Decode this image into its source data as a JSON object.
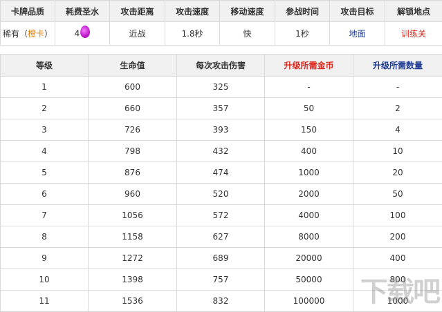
{
  "card": {
    "headers": [
      "卡牌品质",
      "耗费圣水",
      "攻击距离",
      "攻击速度",
      "移动速度",
      "参战时间",
      "攻击目标",
      "解锁地点"
    ],
    "quality_prefix": "稀有（",
    "quality_link": "橙卡",
    "quality_suffix": "）",
    "elixir_cost": "4",
    "elixir_icon": "elixir-drop-icon",
    "range": "近战",
    "attack_speed": "1.8秒",
    "move_speed": "快",
    "deploy_time": "1秒",
    "target": "地面",
    "unlock": "训练关"
  },
  "levels": {
    "headers": [
      "等级",
      "生命值",
      "每次攻击伤害",
      "升级所需金币",
      "升级所需数量"
    ],
    "rows": [
      [
        "1",
        "600",
        "325",
        "-",
        "-"
      ],
      [
        "2",
        "660",
        "357",
        "50",
        "2"
      ],
      [
        "3",
        "726",
        "393",
        "150",
        "4"
      ],
      [
        "4",
        "798",
        "432",
        "400",
        "10"
      ],
      [
        "5",
        "876",
        "474",
        "1000",
        "20"
      ],
      [
        "6",
        "960",
        "520",
        "2000",
        "50"
      ],
      [
        "7",
        "1056",
        "572",
        "4000",
        "100"
      ],
      [
        "8",
        "1158",
        "627",
        "8000",
        "200"
      ],
      [
        "9",
        "1272",
        "689",
        "20000",
        "400"
      ],
      [
        "10",
        "1398",
        "757",
        "50000",
        "800"
      ],
      [
        "11",
        "1536",
        "832",
        "100000",
        "1000"
      ]
    ]
  },
  "colors": {
    "blue": "#1f3a93",
    "orange": "#e6820e",
    "red": "#d9261c",
    "elixir": "#c31fd0"
  },
  "watermark": "下载吧"
}
